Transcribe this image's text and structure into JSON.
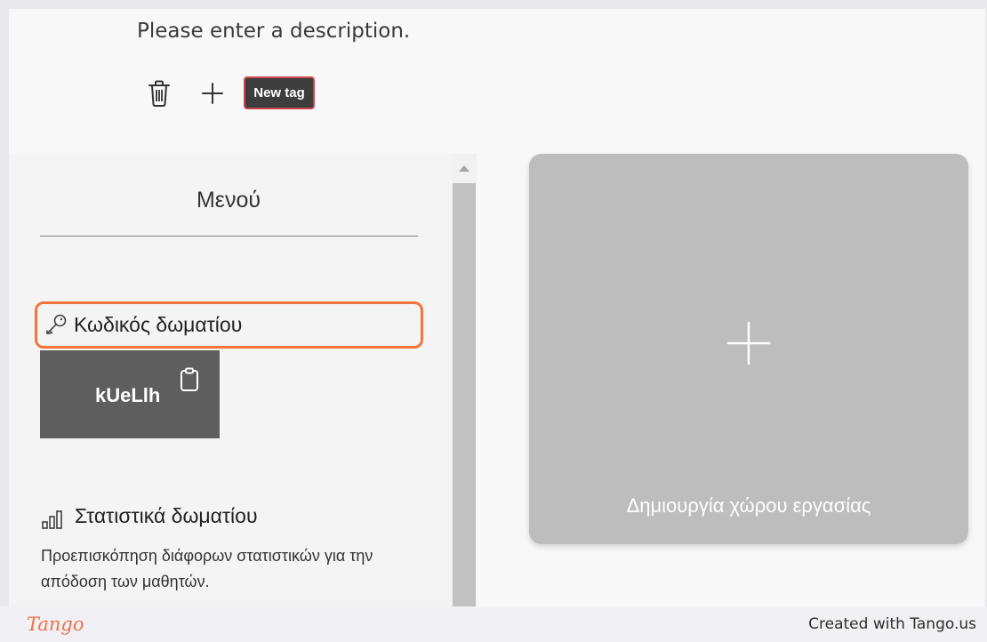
{
  "header": {
    "description": "Please enter a description."
  },
  "tag_toolbar": {
    "delete_icon": "trash-icon",
    "add_icon": "plus-icon",
    "new_tag_label": "New tag"
  },
  "menu": {
    "title": "Μενού",
    "room_code": {
      "icon": "key-icon",
      "label": "Κωδικός δωματίου",
      "value": "kUeLlh",
      "copy_icon": "clipboard-icon"
    },
    "room_stats": {
      "icon": "bar-chart-icon",
      "title": "Στατιστικά δωματίου",
      "description": "Προεπισκόπηση διάφορων στατιστικών για την απόδοση των μαθητών."
    }
  },
  "workspace": {
    "icon": "plus-icon",
    "create_label": "Δημιουργία χώρου εργασίας"
  },
  "footer": {
    "logo": "Tango",
    "credit": "Created with Tango.us"
  },
  "colors": {
    "highlight": "#f4743c",
    "new_tag_border": "#c9464c",
    "tango_brand": "#f17149",
    "room_code_bg": "#5e5e5e",
    "workspace_card": "#bdbdbd"
  }
}
